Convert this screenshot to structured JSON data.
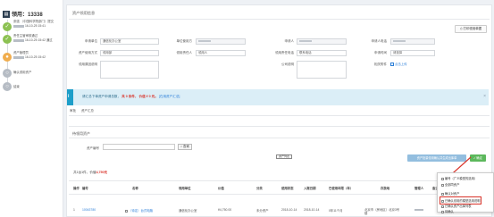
{
  "timeline": {
    "title_icon": "book-icon",
    "title": "领用：13338",
    "steps": [
      {
        "status": "ok",
        "line1": "张强",
        "line2": "（中国科学院部门）提交",
        "line3": "16-10-25 15:41"
      },
      {
        "status": "ok",
        "line1": "责任主管审核通过",
        "line2": "",
        "line3": "16-10-25 15:42 通过"
      },
      {
        "status": "cur",
        "line1": "资产管理员",
        "line2": "",
        "line3": "16-10-25 15:42"
      },
      {
        "status": "wait",
        "line1": "确认领用资产",
        "line2": "",
        "line3": ""
      },
      {
        "status": "wait",
        "line1": "结束",
        "line2": "",
        "line3": ""
      }
    ]
  },
  "panel": {
    "title": "资产领用信息",
    "print_label": "打印领用单据",
    "fields": {
      "apply_unit_label": "申请单位",
      "apply_unit_value": "通信化办公室",
      "dept_label": "单位使用方",
      "apply_person_label": "申请人",
      "apply_phone_label": "申请人电话",
      "asset_use_label": "资产使用方式",
      "asset_use_value": "领用部",
      "receive_person_label": "领用责任人",
      "receive_person_value": "领用人",
      "receive_phone_label": "领用责任电话",
      "receive_phone_value": "联系电话",
      "time_label": "申请时间",
      "time_value": "请选择",
      "reason_label": "领用原因说明",
      "remark_label": "公司说明",
      "attach_label": "相关附件",
      "attach_value": "点击上传"
    }
  },
  "banner": {
    "prefix": "请汇总下单资产申请总数，",
    "count_a": "共 0 条件，",
    "count_b": "价值 ¥ 0 元。",
    "link": "[在用资产汇总]"
  },
  "tabs": [
    "审批",
    "资产汇总"
  ],
  "section": {
    "title": "待领用资产",
    "search_label": "资产编号",
    "search_button": "查询",
    "mid_tag": "资产列表",
    "summary_prefix": "共1台1件，价值",
    "summary_value": "4,750元",
    "batch_button": "资产批量领用确认并生成出库单",
    "confirm_button": "确定"
  },
  "table": {
    "headers": [
      "操作",
      "编号",
      "名称",
      "领用单位",
      "价值",
      "分类",
      "使用状态",
      "入账日期",
      "已使用年限（年）",
      "存放地",
      "管理人",
      "备注"
    ],
    "row": [
      "1",
      "10043780",
      "（待定）台式电脑",
      "通信化办公室",
      "¥4,750.00",
      "未分资产",
      "2018-10-14",
      "2018-10-14",
      "0年11个月",
      "北京市（房地区）北京3号楼",
      "",
      ""
    ]
  },
  "popup": {
    "items": [
      "编号（广义模型的选用）",
      "全部同资产",
      "确认对资产",
      "已确认领用的模型选用说明",
      "已确认资产出库列表",
      "待确认"
    ]
  }
}
